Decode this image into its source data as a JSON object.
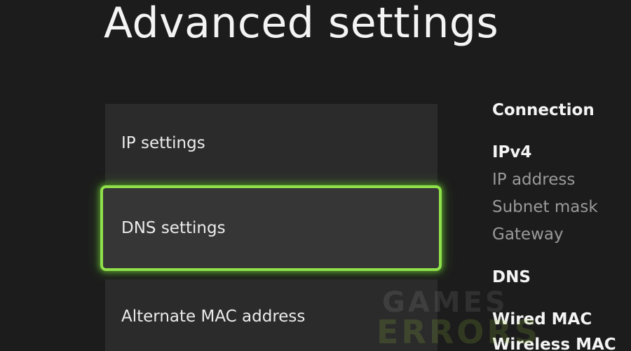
{
  "header": {
    "title": "Advanced settings"
  },
  "menu": {
    "items": [
      {
        "label": "IP settings",
        "selected": false
      },
      {
        "label": "DNS settings",
        "selected": true
      },
      {
        "label": "Alternate MAC address",
        "selected": false
      }
    ],
    "focus_color": "#8fe04a"
  },
  "info": {
    "connection_heading": "Connection",
    "ipv4_heading": "IPv4",
    "ipv4_rows": [
      "IP address",
      "Subnet mask",
      "Gateway"
    ],
    "dns_heading": "DNS",
    "wired_mac_heading": "Wired MAC",
    "wireless_mac_heading": "Wireless MAC"
  },
  "watermark": {
    "line1": "GAMES",
    "line2": "ERRORS"
  }
}
